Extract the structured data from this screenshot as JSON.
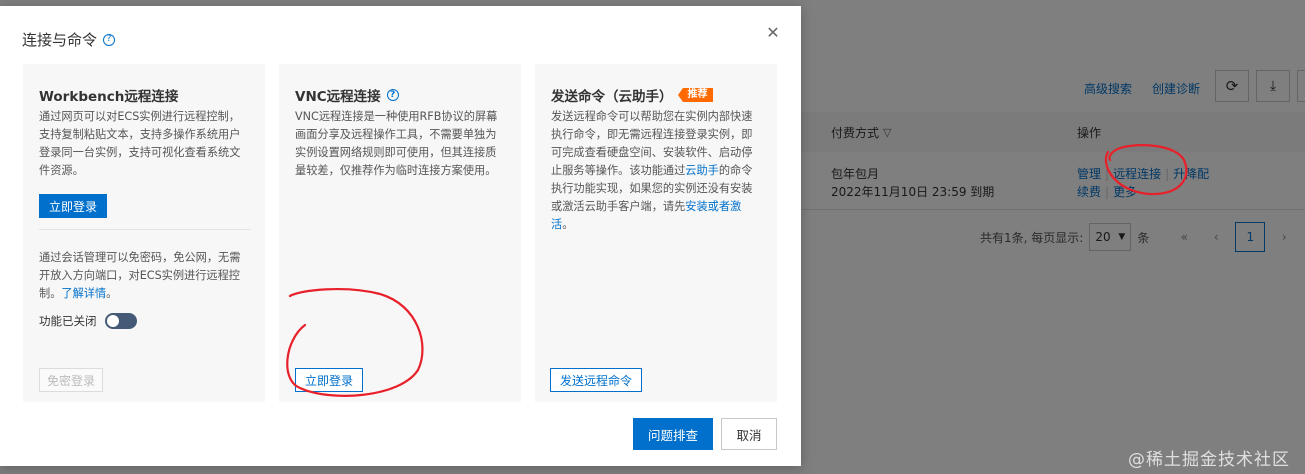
{
  "background": {
    "links": [
      "高级搜索",
      "创建诊断"
    ],
    "columns": {
      "billing": "付费方式",
      "actions": "操作"
    },
    "row": {
      "billing_type": "包年包月",
      "expiry": "2022年11月10日 23:59 到期",
      "ops_line1": [
        "管理",
        "远程连接",
        "升降配"
      ],
      "ops_line2": [
        "续费",
        "更多"
      ]
    },
    "pagination": {
      "total_text": "共有1条, 每页显示:",
      "page_size": "20",
      "unit": "条",
      "current_page": "1"
    }
  },
  "dialog": {
    "title": "连接与命令",
    "cards": {
      "workbench": {
        "title": "Workbench远程连接",
        "desc": "通过网页可以对ECS实例进行远程控制，支持复制粘贴文本，支持多操作系统用户登录同一台实例，支持可视化查看系统文件资源。",
        "login_btn": "立即登录",
        "session_desc": "通过会话管理可以免密码，免公网，无需开放入方向端口，对ECS实例进行远程控制。",
        "learn_more": "了解详情",
        "learn_more_suffix": "。",
        "toggle_label": "功能已关闭",
        "toggle_on": false,
        "passwordless_btn": "免密登录"
      },
      "vnc": {
        "title": "VNC远程连接",
        "desc": "VNC远程连接是一种使用RFB协议的屏幕画面分享及远程操作工具，不需要单独为实例设置网络规则即可使用，但其连接质量较差，仅推荐作为临时连接方案使用。",
        "login_btn": "立即登录"
      },
      "command": {
        "title": "发送命令（云助手）",
        "badge": "推荐",
        "desc_part1": "发送远程命令可以帮助您在实例内部快速执行命令，即无需远程连接登录实例，即可完成查看硬盘空间、安装软件、启动停止服务等操作。该功能通过",
        "desc_link1": "云助手",
        "desc_part2": "的命令执行功能实现，如果您的实例还没有安装或激活云助手客户端，请先",
        "desc_link2": "安装或者激活",
        "desc_part3": "。",
        "send_btn": "发送远程命令"
      }
    },
    "footer": {
      "troubleshoot": "问题排查",
      "cancel": "取消"
    }
  },
  "watermark": "@稀土掘金技术社区",
  "colors": {
    "primary": "#0070cc",
    "badge": "#ff6a00",
    "annotation": "#e8202a",
    "toggle_off": "#455a76"
  }
}
